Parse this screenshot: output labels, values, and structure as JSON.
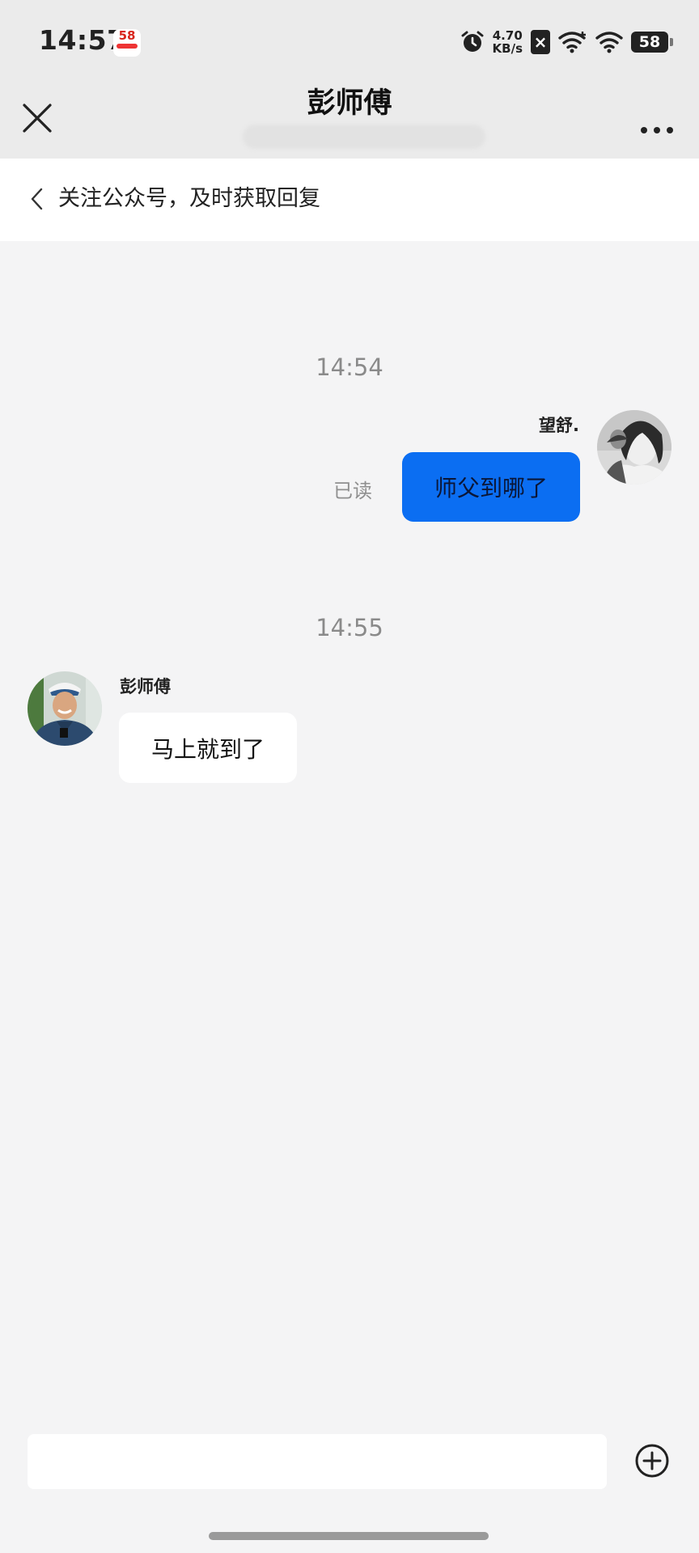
{
  "status_bar": {
    "time": "14:57",
    "app_badge": "58",
    "net_speed_value": "4.70",
    "net_speed_unit": "KB/s",
    "battery": "58"
  },
  "header": {
    "title": "彭师傅"
  },
  "banner": {
    "text": "关注公众号，及时获取回复"
  },
  "messages": [
    {
      "timestamp": "14:54",
      "sender": "望舒.",
      "direction": "outgoing",
      "text": "师父到哪了",
      "status": "已读"
    },
    {
      "timestamp": "14:55",
      "sender": "彭师傅",
      "direction": "incoming",
      "text": "马上就到了"
    }
  ],
  "colors": {
    "outgoing_bubble": "#0b6ef2",
    "incoming_bubble": "#ffffff",
    "background": "#f4f4f5",
    "header": "#ebebeb"
  },
  "icons": {
    "close": "close-icon",
    "more": "more-icon",
    "banner_back": "chevron-left-icon",
    "add": "plus-circle-icon"
  }
}
